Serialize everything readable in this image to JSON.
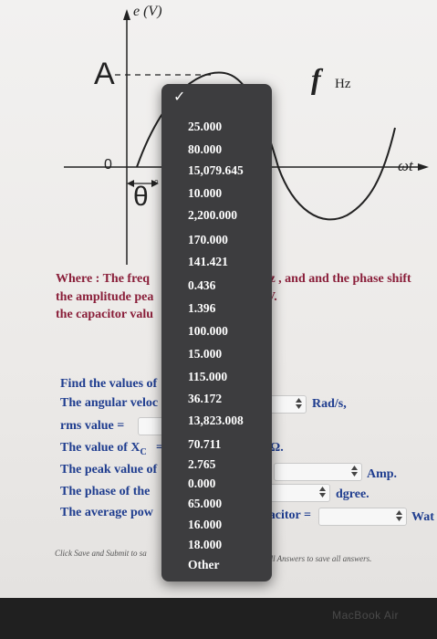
{
  "figure": {
    "y_axis_label": "e (V)",
    "amplitude_label": "A",
    "freq_label": "f",
    "freq_unit": "Hz",
    "origin_label": "0",
    "phase_label": "θ",
    "phase_unit": "°",
    "time_label": "ωt"
  },
  "problem": {
    "line1_left": "Where : The freq",
    "line1_right": "Iz , and and the phase shift",
    "line2_left": "the amplitude pea",
    "line2_right": "V.",
    "line3_left": "the capacitor valu"
  },
  "questions": {
    "find": "Find the values of",
    "angular": "The angular veloc",
    "angular_unit": "Rad/s,",
    "rms": "rms value =",
    "xc_prefix": "The value of X",
    "xc_sub": "C",
    "xc_eq": "=",
    "xc_unit": "Ω.",
    "peak": "The peak value of",
    "peak_eq": "=",
    "peak_unit": "Amp.",
    "phase": "The phase of the",
    "phase_unit": "dgree.",
    "avg": "The average pow",
    "avg_mid": "pacitor =",
    "avg_unit": "Wat"
  },
  "footer": {
    "left": "Click Save and Submit to sa",
    "right": "e All Answers to save all answers."
  },
  "dropdown": {
    "checkmark": "✓",
    "options": [
      "25.000",
      "80.000",
      "15,079.645",
      "10.000",
      "2,200.000",
      "170.000",
      "141.421",
      "0.436",
      "1.396",
      "100.000",
      "15.000",
      "115.000",
      "36.172",
      "13,823.008",
      "70.711",
      "2.765",
      "0.000",
      "65.000",
      "16.000",
      "18.000",
      "Other"
    ]
  },
  "device": {
    "label": "MacBook Air"
  }
}
